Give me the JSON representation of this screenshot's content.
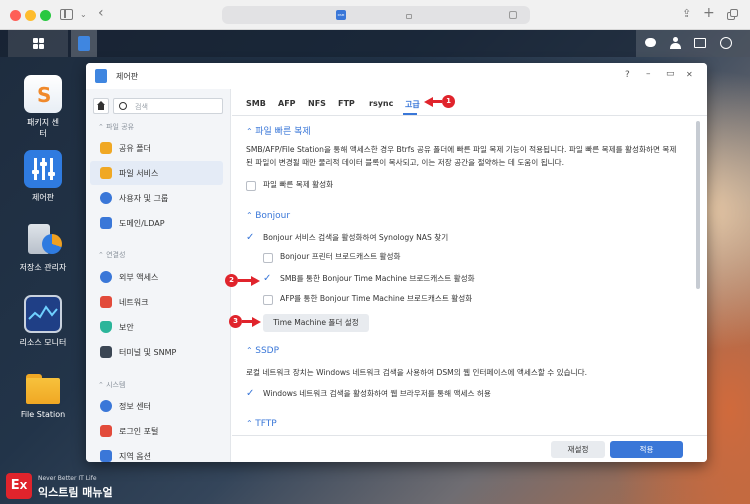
{
  "browser": {
    "site_badge": "DSM"
  },
  "desktop": {
    "icons": [
      {
        "label": "패키지 센터"
      },
      {
        "label": "제어판"
      },
      {
        "label": "저장소 관리자"
      },
      {
        "label": "리소스 모니터"
      },
      {
        "label": "File Station"
      }
    ]
  },
  "window": {
    "title": "제어판",
    "help": "?",
    "min": "–",
    "max": "▭",
    "close": "✕"
  },
  "sidebar": {
    "search_placeholder": "검색",
    "sections": [
      {
        "label": "파일 공유"
      },
      {
        "label": "연결성"
      },
      {
        "label": "시스템"
      }
    ],
    "items": [
      {
        "label": "공유 폴더"
      },
      {
        "label": "파일 서비스"
      },
      {
        "label": "사용자 및 그룹"
      },
      {
        "label": "도메인/LDAP"
      },
      {
        "label": "외부 액세스"
      },
      {
        "label": "네트워크"
      },
      {
        "label": "보안"
      },
      {
        "label": "터미널 및 SNMP"
      },
      {
        "label": "정보 센터"
      },
      {
        "label": "로그인 포털"
      },
      {
        "label": "지역 옵션"
      }
    ]
  },
  "tabs": [
    {
      "label": "SMB"
    },
    {
      "label": "AFP"
    },
    {
      "label": "NFS"
    },
    {
      "label": "FTP"
    },
    {
      "label": "rsync"
    },
    {
      "label": "고급",
      "active": true
    }
  ],
  "content": {
    "fast_clone": {
      "title": "파일 빠른 복제",
      "desc_line1": "SMB/AFP/File Station을 통해 액세스한 경우 Btrfs 공유 폴더에 빠른 파일 복제 기능이 적용됩니다. 파일 빠른 복제를 활성화하면 복제",
      "desc_line2": "된 파일이 변경될 때만 물리적 데이터 블록이 복사되고, 이는 저장 공간을 절약하는 데 도움이 됩니다.",
      "checkbox": {
        "label": "파일 빠른 복제 활성화",
        "checked": false
      }
    },
    "bonjour": {
      "title": "Bonjour",
      "enable": {
        "label": "Bonjour 서비스 검색을 활성화하여 Synology NAS 찾기",
        "checked": true
      },
      "printer": {
        "label": "Bonjour 프린터 브로드캐스트 활성화",
        "checked": false
      },
      "smb_tm": {
        "label": "SMB를 통한 Bonjour Time Machine 브로드캐스트 활성화",
        "checked": true
      },
      "afp_tm": {
        "label": "AFP를 통한 Bonjour Time Machine 브로드캐스트 활성화",
        "checked": false
      },
      "tm_button": "Time Machine 폴더 설정"
    },
    "ssdp": {
      "title": "SSDP",
      "desc": "로컬 네트워크 장치는 Windows 네트워크 검색을 사용하여 DSM의 웹 인터페이스에 액세스할 수 있습니다.",
      "checkbox": {
        "label": "Windows 네트워크 검색을 활성화하여 웹 브라우저를 통해 액세스 허용",
        "checked": true
      }
    },
    "tftp": {
      "title": "TFTP"
    }
  },
  "footer": {
    "reset": "재설정",
    "apply": "적용"
  },
  "annotations": [
    "1",
    "2",
    "3"
  ],
  "watermark": {
    "line1": "Never Better IT Life",
    "line2": "익스트림 매뉴얼"
  },
  "colors": {
    "accent": "#3a77d8",
    "callout": "#e0242c"
  }
}
